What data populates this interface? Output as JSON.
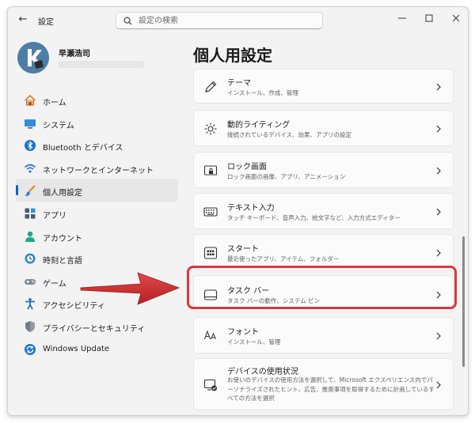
{
  "window": {
    "title": "設定",
    "search_placeholder": "設定の検索",
    "search_value": "",
    "icons": [
      "back-arrow-icon",
      "search-icon",
      "minimize-icon",
      "maximize-icon",
      "close-icon"
    ]
  },
  "user": {
    "name": "早瀬浩司",
    "avatar_icon": "user-avatar-icon"
  },
  "sidebar": {
    "items": [
      {
        "label": "ホーム",
        "icon": "home-icon",
        "active": false
      },
      {
        "label": "システム",
        "icon": "system-icon",
        "active": false
      },
      {
        "label": "Bluetooth とデバイス",
        "icon": "bluetooth-icon",
        "active": false
      },
      {
        "label": "ネットワークとインターネット",
        "icon": "wifi-icon",
        "active": false
      },
      {
        "label": "個人用設定",
        "icon": "brush-icon",
        "active": true
      },
      {
        "label": "アプリ",
        "icon": "apps-icon",
        "active": false
      },
      {
        "label": "アカウント",
        "icon": "account-icon",
        "active": false
      },
      {
        "label": "時刻と言語",
        "icon": "clock-globe-icon",
        "active": false
      },
      {
        "label": "ゲーム",
        "icon": "gamepad-icon",
        "active": false
      },
      {
        "label": "アクセシビリティ",
        "icon": "accessibility-icon",
        "active": false
      },
      {
        "label": "プライバシーとセキュリティ",
        "icon": "shield-icon",
        "active": false
      },
      {
        "label": "Windows Update",
        "icon": "update-icon",
        "active": false
      }
    ]
  },
  "main": {
    "title": "個人用設定",
    "cards": [
      {
        "title": "テーマ",
        "subtitle": "インストール、作成、管理",
        "icon": "pen-icon"
      },
      {
        "title": "動的ライティング",
        "subtitle": "接続されているデバイス、効果、アプリの設定",
        "icon": "sun-icon"
      },
      {
        "title": "ロック画面",
        "subtitle": "ロック画面の画像、アプリ、アニメーション",
        "icon": "lock-screen-icon"
      },
      {
        "title": "テキスト入力",
        "subtitle": "タッチ キーボード、音声入力、絵文字など、入力方式エディター",
        "icon": "keyboard-icon"
      },
      {
        "title": "スタート",
        "subtitle": "最近使ったアプリ、アイテム、フォルダー",
        "icon": "start-icon"
      },
      {
        "title": "タスク バー",
        "subtitle": "タスク バーの動作、システム ピン",
        "icon": "taskbar-icon"
      },
      {
        "title": "フォント",
        "subtitle": "インストール、管理",
        "icon": "font-icon"
      },
      {
        "title": "デバイスの使用状況",
        "subtitle": "お使いのデバイスの使用方法を選択して、Microsoft エクスペリエンス内でパーソナライズされたヒント、広告、推奨事項を取得するために計画しているすべての方法を選択",
        "icon": "device-usage-icon"
      }
    ]
  },
  "colors": {
    "accent": "#0067c0",
    "highlight_red": "#e0353b",
    "window_bg": "#f3f3f3",
    "card_bg": "#fbfbfb"
  }
}
